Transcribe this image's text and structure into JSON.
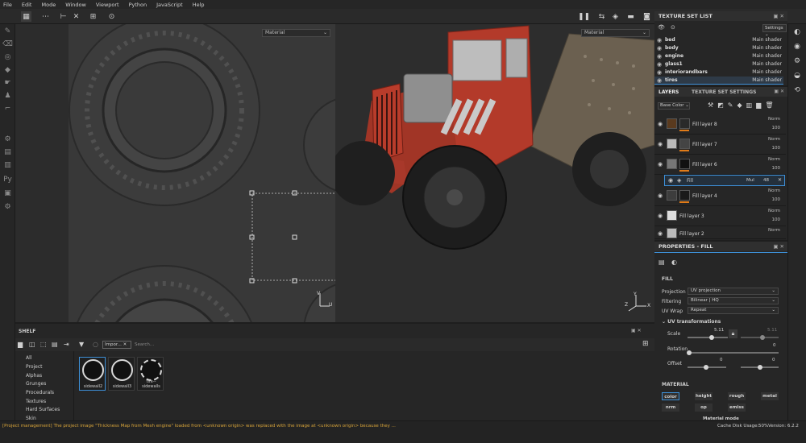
{
  "menubar": [
    "File",
    "Edit",
    "Mode",
    "Window",
    "Viewport",
    "Python",
    "JavaScript",
    "Help"
  ],
  "viewport": {
    "left_select": "Material",
    "right_select": "Material",
    "axis_u": "U",
    "axis_v": "V",
    "axis_x": "X",
    "axis_y": "Y",
    "axis_z": "Z"
  },
  "texture_set_list": {
    "title": "TEXTURE SET LIST",
    "settings": "Settings",
    "rows": [
      {
        "name": "bed",
        "shader": "Main shader"
      },
      {
        "name": "body",
        "shader": "Main shader"
      },
      {
        "name": "engine",
        "shader": "Main shader"
      },
      {
        "name": "glass1",
        "shader": "Main shader"
      },
      {
        "name": "interiorandbars",
        "shader": "Main shader"
      },
      {
        "name": "tires",
        "shader": "Main shader"
      }
    ]
  },
  "layers": {
    "tab_layers": "LAYERS",
    "tab_tss": "TEXTURE SET SETTINGS",
    "channel": "Base Color",
    "rows": [
      {
        "name": "Fill layer 8",
        "blend": "Norm",
        "opacity": "100"
      },
      {
        "name": "Fill layer 7",
        "blend": "Norm",
        "opacity": "100"
      },
      {
        "name": "Fill layer 6",
        "blend": "Norm",
        "opacity": "100"
      },
      {
        "name": "Fill",
        "blend": "Mul",
        "opacity": "48"
      },
      {
        "name": "Fill layer 4",
        "blend": "Norm",
        "opacity": "100"
      },
      {
        "name": "Fill layer 3",
        "blend": "Norm",
        "opacity": "100"
      },
      {
        "name": "Fill layer 2",
        "blend": "Norm",
        "opacity": "100"
      }
    ]
  },
  "properties": {
    "title": "PROPERTIES - FILL",
    "section_fill": "FILL",
    "projection_label": "Projection",
    "projection_value": "UV projection",
    "filtering_label": "Filtering",
    "filtering_value": "Bilinear | HQ",
    "uvwrap_label": "UV Wrap",
    "uvwrap_value": "Repeat",
    "uvtrans": "UV transformations",
    "scale_label": "Scale",
    "scale_value": "5.11",
    "scale_value2": "5.11",
    "rotation_label": "Rotation",
    "rotation_value": "0",
    "offset_label": "Offset",
    "offset_x": "0",
    "offset_y": "0",
    "section_material": "MATERIAL",
    "channels": [
      "color",
      "height",
      "rough",
      "metal",
      "nrm",
      "op",
      "emiss"
    ],
    "material_mode": "Material mode"
  },
  "shelf": {
    "title": "SHELF",
    "filter_tag": "Impor...",
    "search_placeholder": "Search...",
    "categories": [
      "All",
      "Project",
      "Alphas",
      "Grunges",
      "Procedurals",
      "Textures",
      "Hard Surfaces",
      "Skin"
    ],
    "items": [
      "sidewall2",
      "sidewall3",
      "tire--sidewalls"
    ]
  },
  "status": {
    "message": "[Project management] The project image \"Thickness Map from Mesh engine\" loaded from <unknown origin> was replaced with the image at <unknown origin> because they ...",
    "cache": "Cache Disk Usage:",
    "cache_value": "50%",
    "version": "Version: 6.2.2"
  },
  "colors": {
    "accent": "#3d8fd6",
    "orange": "#e07b19",
    "warn_text": "#d9a53a",
    "truck_red": "#b33a2a"
  }
}
